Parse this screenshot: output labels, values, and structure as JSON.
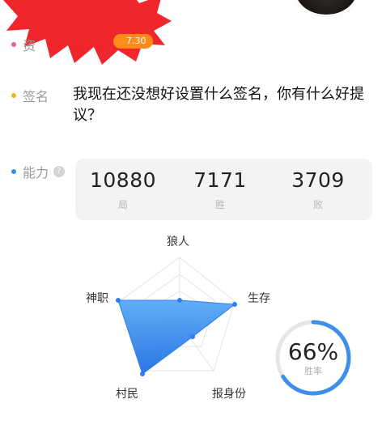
{
  "profile": {
    "zi_label": "资",
    "zi_tag": "7.30",
    "signature_label": "签名",
    "signature_text": "我现在还没想好设置什么签名，你有什么好提议？",
    "ability_label": "能力",
    "help_glyph": "?"
  },
  "stats": {
    "games": {
      "value": "10880",
      "label": "局"
    },
    "wins": {
      "value": "7171",
      "label": "胜"
    },
    "losses": {
      "value": "3709",
      "label": "败"
    }
  },
  "radar": {
    "axes": [
      "狼人",
      "生存",
      "报身份",
      "村民",
      "神职"
    ]
  },
  "win_rate": {
    "value": "66%",
    "label": "胜率",
    "fraction": 0.66
  },
  "colors": {
    "accent": "#2d7ef0",
    "ring": "#3d8fe9",
    "ring_track": "#e6e6e6",
    "burst": "#f0262d",
    "tag": "#ff8c1a",
    "dot_pink": "#ee5d9c",
    "dot_yellow": "#f5b800",
    "dot_blue": "#3a8ee6"
  }
}
